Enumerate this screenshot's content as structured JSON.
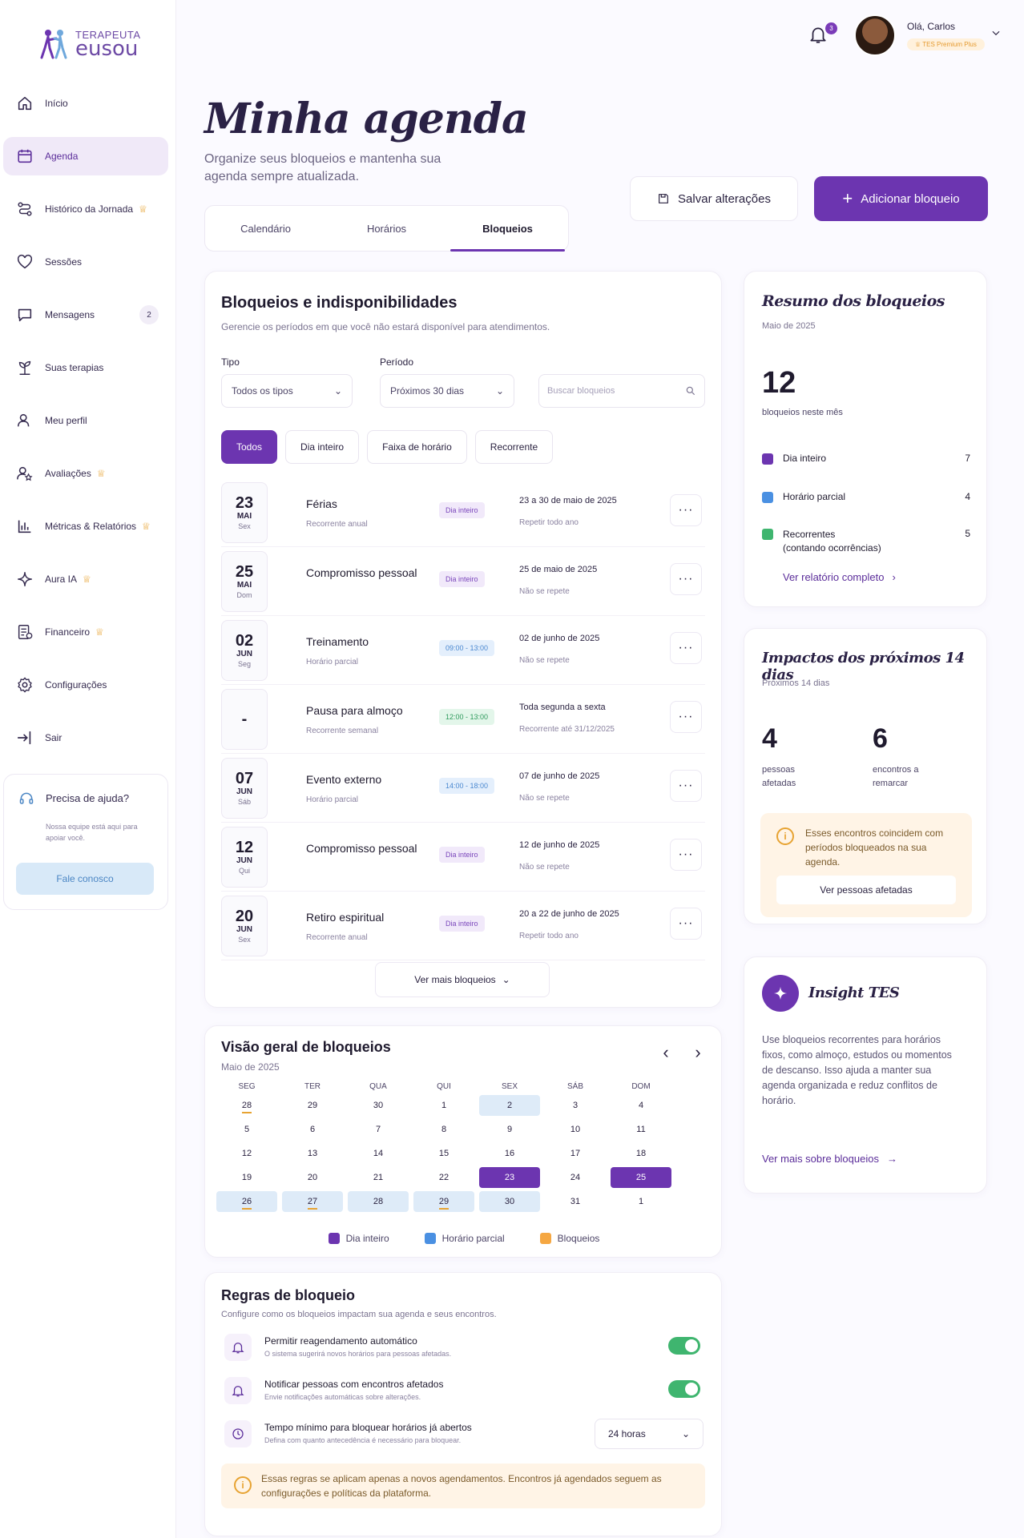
{
  "brand": {
    "top": "TERAPEUTA",
    "bottom": "eusou"
  },
  "sidebar": {
    "items": [
      {
        "label": "Início",
        "icon": "home-icon"
      },
      {
        "label": "Agenda",
        "icon": "calendar-icon"
      },
      {
        "label": "Histórico da Jornada",
        "icon": "route-icon",
        "premium": true
      },
      {
        "label": "Sessões",
        "icon": "heart-icon"
      },
      {
        "label": "Mensagens",
        "icon": "message-icon",
        "count": "2"
      },
      {
        "label": "Suas terapias",
        "icon": "plant-icon"
      },
      {
        "label": "Meu perfil",
        "icon": "user-icon"
      },
      {
        "label": "Avaliações",
        "icon": "user-star-icon",
        "premium": true
      },
      {
        "label": "Métricas & Relatórios",
        "icon": "bar-chart-icon",
        "premium": true
      },
      {
        "label": "Aura IA",
        "icon": "sparkle-icon",
        "premium": true
      },
      {
        "label": "Financeiro",
        "icon": "receipt-icon",
        "premium": true
      },
      {
        "label": "Configurações",
        "icon": "gear-icon"
      },
      {
        "label": "Sair",
        "icon": "logout-icon"
      }
    ],
    "help": {
      "title": "Precisa de ajuda?",
      "text": "Nossa equipe está aqui para apoiar você.",
      "button": "Fale conosco"
    }
  },
  "topbar": {
    "notifications": "3",
    "hello": "Olá, Carlos",
    "plan": "TES Premium Plus"
  },
  "page": {
    "title": "Minha agenda",
    "subtitle": "Organize seus bloqueios e mantenha sua agenda sempre atualizada."
  },
  "tabs": [
    "Calendário",
    "Horários",
    "Bloqueios"
  ],
  "actions": {
    "save": "Salvar alterações",
    "add": "Adicionar bloqueio"
  },
  "blocks": {
    "title": "Bloqueios e indisponibilidades",
    "subtitle": "Gerencie os períodos em que você não estará disponível para atendimentos.",
    "type_label": "Tipo",
    "type_value": "Todos os tipos",
    "period_label": "Período",
    "period_value": "Próximos 30 dias",
    "search_placeholder": "Buscar bloqueios",
    "filters": [
      "Todos",
      "Dia inteiro",
      "Faixa de horário",
      "Recorrente"
    ],
    "more": "Ver mais bloqueios",
    "items": [
      {
        "day": "23",
        "month": "MAI",
        "dow": "Sex",
        "title": "Férias",
        "kind": "Recorrente anual",
        "badge": "Dia inteiro",
        "badge_type": "day",
        "when": "23 a 30 de maio de 2025",
        "repeat": "Repetir todo ano"
      },
      {
        "day": "25",
        "month": "MAI",
        "dow": "Dom",
        "title": "Compromisso pessoal",
        "kind": "",
        "badge": "Dia inteiro",
        "badge_type": "day",
        "when": "25 de maio de 2025",
        "repeat": "Não se repete"
      },
      {
        "day": "02",
        "month": "JUN",
        "dow": "Seg",
        "title": "Treinamento",
        "kind": "Horário parcial",
        "badge": "09:00 - 13:00",
        "badge_type": "blue",
        "when": "02 de junho de 2025",
        "repeat": "Não se repete"
      },
      {
        "day": "-",
        "month": "",
        "dow": "",
        "title": "Pausa para almoço",
        "kind": "Recorrente semanal",
        "badge": "12:00 - 13:00",
        "badge_type": "green",
        "when": "Toda segunda a sexta",
        "repeat": "Recorrente até 31/12/2025"
      },
      {
        "day": "07",
        "month": "JUN",
        "dow": "Sáb",
        "title": "Evento externo",
        "kind": "Horário parcial",
        "badge": "14:00 - 18:00",
        "badge_type": "blue",
        "when": "07 de junho de 2025",
        "repeat": "Não se repete"
      },
      {
        "day": "12",
        "month": "JUN",
        "dow": "Qui",
        "title": "Compromisso pessoal",
        "kind": "",
        "badge": "Dia inteiro",
        "badge_type": "day",
        "when": "12 de junho de 2025",
        "repeat": "Não se repete"
      },
      {
        "day": "20",
        "month": "JUN",
        "dow": "Sex",
        "title": "Retiro espiritual",
        "kind": "Recorrente anual",
        "badge": "Dia inteiro",
        "badge_type": "day",
        "when": "20 a 22 de junho de 2025",
        "repeat": "Repetir todo ano"
      }
    ]
  },
  "calendar": {
    "title": "Visão geral de bloqueios",
    "month": "Maio de 2025",
    "weekdays": [
      "SEG",
      "TER",
      "QUA",
      "QUI",
      "SEX",
      "SÁB",
      "DOM"
    ],
    "weeks": [
      [
        {
          "d": "28",
          "s": "today"
        },
        {
          "d": "29"
        },
        {
          "d": "30"
        },
        {
          "d": "1"
        },
        {
          "d": "2",
          "s": "light"
        },
        {
          "d": "3"
        },
        {
          "d": "4"
        }
      ],
      [
        {
          "d": "5"
        },
        {
          "d": "6"
        },
        {
          "d": "7"
        },
        {
          "d": "8"
        },
        {
          "d": "9"
        },
        {
          "d": "10"
        },
        {
          "d": "11"
        }
      ],
      [
        {
          "d": "12"
        },
        {
          "d": "13"
        },
        {
          "d": "14"
        },
        {
          "d": "15"
        },
        {
          "d": "16"
        },
        {
          "d": "17"
        },
        {
          "d": "18"
        }
      ],
      [
        {
          "d": "19"
        },
        {
          "d": "20"
        },
        {
          "d": "21"
        },
        {
          "d": "22"
        },
        {
          "d": "23",
          "s": "full"
        },
        {
          "d": "24"
        },
        {
          "d": "25",
          "s": "full"
        }
      ],
      [
        {
          "d": "26",
          "s": "light-today"
        },
        {
          "d": "27",
          "s": "light-today"
        },
        {
          "d": "28",
          "s": "light"
        },
        {
          "d": "29",
          "s": "light-today"
        },
        {
          "d": "30",
          "s": "light"
        },
        {
          "d": "31"
        },
        {
          "d": "1"
        }
      ]
    ],
    "legend": [
      {
        "label": "Dia inteiro",
        "color": "#6c35b0"
      },
      {
        "label": "Horário parcial",
        "color": "#4a90e2"
      },
      {
        "label": "Bloqueios",
        "color": "#f5a742"
      }
    ]
  },
  "rules": {
    "title": "Regras de bloqueio",
    "subtitle": "Configure como os bloqueios impactam sua agenda e seus encontros.",
    "items": [
      {
        "title": "Permitir reagendamento automático",
        "desc": "O sistema sugerirá novos horários para pessoas afetadas.",
        "icon": "bell-icon",
        "on": true
      },
      {
        "title": "Notificar pessoas com encontros afetados",
        "desc": "Envie notificações automáticas sobre alterações.",
        "icon": "bell-icon",
        "on": true
      },
      {
        "title": "Tempo mínimo para bloquear horários já abertos",
        "desc": "Defina com quanto antecedência é necessário para bloquear.",
        "icon": "clock-icon",
        "value": "24 horas"
      }
    ],
    "note": "Essas regras se aplicam apenas a novos agendamentos. Encontros já agendados seguem as configurações e políticas da plataforma."
  },
  "summary": {
    "title": "Resumo dos bloqueios",
    "month": "Maio de 2025",
    "total": "12",
    "total_label": "bloqueios neste mês",
    "rows": [
      {
        "label": "Dia inteiro",
        "sub": "",
        "count": "7",
        "color": "#6c35b0"
      },
      {
        "label": "Horário parcial",
        "sub": "",
        "count": "4",
        "color": "#4a90e2"
      },
      {
        "label": "Recorrentes",
        "sub": "(contando ocorrências)",
        "count": "5",
        "color": "#3fb56f"
      }
    ],
    "link": "Ver relatório completo"
  },
  "impact": {
    "title": "Impactos dos próximos 14 dias",
    "sub": "Próximos 14 dias",
    "people": "4",
    "people_label": "pessoas afetadas",
    "meetings": "6",
    "meetings_label": "encontros a remarcar",
    "alert": "Esses encontros coincidem com períodos bloqueados na sua agenda.",
    "button": "Ver pessoas afetadas"
  },
  "insight": {
    "title": "Insight TES",
    "text": "Use bloqueios recorrentes para horários fixos, como almoço, estudos ou momentos de descanso. Isso ajuda a manter sua agenda organizada e reduz conflitos de horário.",
    "link": "Ver mais sobre bloqueios"
  }
}
